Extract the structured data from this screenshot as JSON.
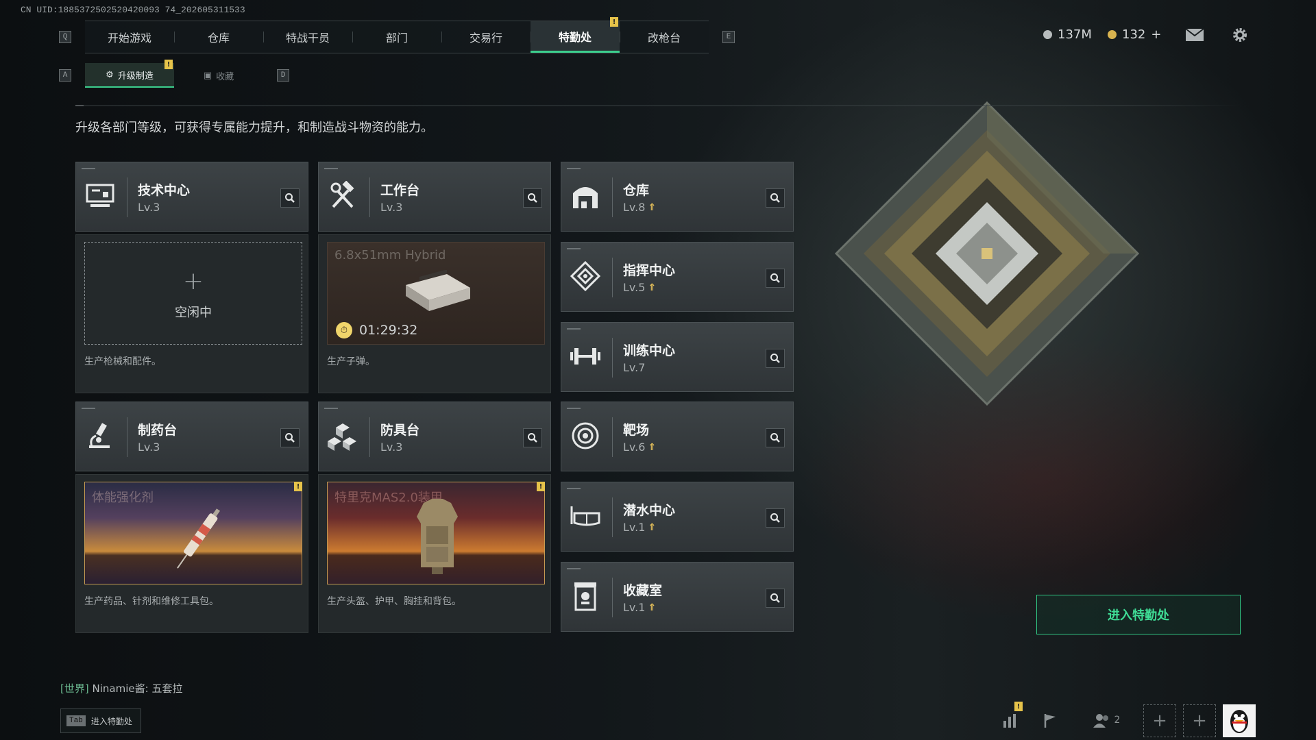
{
  "uid": "CN UID:1885372502520420093 74_202605311533",
  "nav": {
    "left_key": "Q",
    "right_key": "E",
    "tabs": [
      {
        "label": "开始游戏"
      },
      {
        "label": "仓库"
      },
      {
        "label": "特战干员"
      },
      {
        "label": "部门"
      },
      {
        "label": "交易行"
      },
      {
        "label": "特勤处",
        "active": true,
        "badge": "!"
      },
      {
        "label": "改枪台"
      }
    ]
  },
  "currency": {
    "silver": "137M",
    "gold": "132",
    "gold_add": "+"
  },
  "subnav": {
    "left_key": "A",
    "right_key": "D",
    "tabs": [
      {
        "label": "升级制造",
        "active": true,
        "badge": "!"
      },
      {
        "label": "收藏"
      }
    ]
  },
  "description": "升级各部门等级，可获得专属能力提升，和制造战斗物资的能力。",
  "departments": [
    {
      "name": "技术中心",
      "level": "Lv.3",
      "icon": "computer-icon"
    },
    {
      "name": "工作台",
      "level": "Lv.3",
      "icon": "tools-icon"
    },
    {
      "name": "仓库",
      "level": "Lv.8",
      "icon": "warehouse-icon",
      "upgrade": true
    },
    {
      "name": "指挥中心",
      "level": "Lv.5",
      "icon": "command-icon",
      "upgrade": true
    },
    {
      "name": "训练中心",
      "level": "Lv.7",
      "icon": "dumbbell-icon"
    },
    {
      "name": "制药台",
      "level": "Lv.3",
      "icon": "microscope-icon"
    },
    {
      "name": "防具台",
      "level": "Lv.3",
      "icon": "blocks-icon"
    },
    {
      "name": "靶场",
      "level": "Lv.6",
      "icon": "target-icon",
      "upgrade": true
    },
    {
      "name": "潜水中心",
      "level": "Lv.1",
      "icon": "diving-mask-icon",
      "upgrade": true
    },
    {
      "name": "收藏室",
      "level": "Lv.1",
      "icon": "collection-icon",
      "upgrade": true
    }
  ],
  "production": {
    "tech": {
      "state": "空闲中",
      "desc": "生产枪械和配件。"
    },
    "workbench": {
      "item": "6.8x51mm Hybrid",
      "timer": "01:29:32",
      "desc": "生产子弹。"
    },
    "pharmacy": {
      "item": "体能强化剂",
      "desc": "生产药品、针剂和维修工具包。",
      "badge": "!"
    },
    "armor": {
      "item": "特里克MAS2.0装甲",
      "desc": "生产头盔、护甲、胸挂和背包。",
      "badge": "!"
    }
  },
  "enter_button": "进入特勤处",
  "chat": {
    "channel": "[世界]",
    "user": "Ninamie酱:",
    "message": "五套拉"
  },
  "tab_hint": {
    "key": "Tab",
    "label": "进入特勤处"
  },
  "friends_count": "2",
  "bottom_badge": "!",
  "colors": {
    "accent": "#3ccf8e",
    "warning": "#e6c34a",
    "upgrade": "#e9c35b"
  }
}
